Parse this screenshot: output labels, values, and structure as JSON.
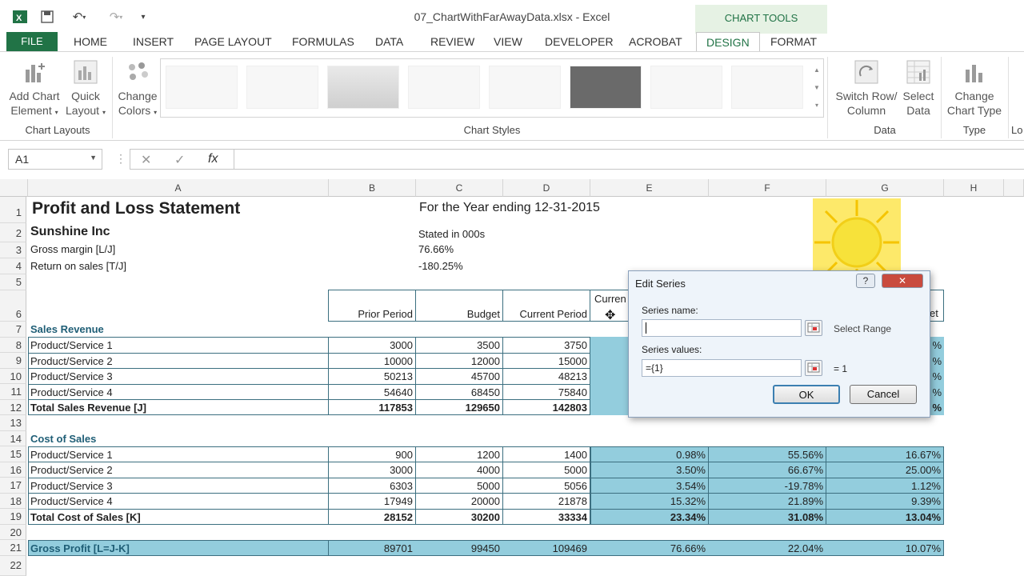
{
  "window": {
    "title": "07_ChartWithFarAwayData.xlsx - Excel",
    "context_tab_group": "CHART TOOLS",
    "colors": {
      "accent": "#217346",
      "fill_blue": "#93cddd",
      "teal_text": "#1f5e76"
    }
  },
  "tabs": {
    "file": "FILE",
    "items": [
      "HOME",
      "INSERT",
      "PAGE LAYOUT",
      "FORMULAS",
      "DATA",
      "REVIEW",
      "VIEW",
      "DEVELOPER",
      "ACROBAT",
      "DESIGN",
      "FORMAT"
    ],
    "active": "DESIGN"
  },
  "ribbon": {
    "add_chart_element": [
      "Add Chart",
      "Element"
    ],
    "quick_layout": [
      "Quick",
      "Layout"
    ],
    "change_colors": [
      "Change",
      "Colors"
    ],
    "switch_row_col": [
      "Switch Row/",
      "Column"
    ],
    "select_data": [
      "Select",
      "Data"
    ],
    "change_chart_type": [
      "Change",
      "Chart Type"
    ],
    "groups": {
      "chart_layouts": "Chart Layouts",
      "chart_styles": "Chart Styles",
      "data": "Data",
      "type": "Type",
      "cut_off": "Lo"
    }
  },
  "formula_bar": {
    "name_box": "A1",
    "fx": "fx",
    "value": ""
  },
  "columns": [
    "A",
    "B",
    "C",
    "D",
    "E",
    "F",
    "G",
    "H"
  ],
  "rows": [
    "1",
    "2",
    "3",
    "4",
    "5",
    "6",
    "7",
    "8",
    "9",
    "10",
    "11",
    "12",
    "13",
    "14",
    "15",
    "16",
    "17",
    "18",
    "19",
    "20",
    "21",
    "22"
  ],
  "sheet": {
    "title": "Profit and Loss Statement",
    "year_note": "For the Year ending 12-31-2015",
    "company": "Sunshine Inc",
    "stated": "Stated in 000s",
    "gross_margin_label": "Gross margin  [L/J]",
    "gross_margin_value": "76.66%",
    "ros_label": "Return on sales  [T/J]",
    "ros_value": "-180.25%",
    "headers": {
      "prior": "Prior Period",
      "budget": "Budget",
      "current": "Current Period",
      "e_partial": "Curren",
      "g_partial": "et"
    },
    "sales_revenue": "Sales Revenue",
    "sales_rows": [
      {
        "label": "Product/Service 1",
        "b": "3000",
        "c": "3500",
        "d": "3750"
      },
      {
        "label": "Product/Service 2",
        "b": "10000",
        "c": "12000",
        "d": "15000"
      },
      {
        "label": "Product/Service 3",
        "b": "50213",
        "c": "45700",
        "d": "48213"
      },
      {
        "label": "Product/Service 4",
        "b": "54640",
        "c": "68450",
        "d": "75840"
      }
    ],
    "sales_total": {
      "label": "Total Sales Revenue  [J]",
      "b": "117853",
      "c": "129650",
      "d": "142803"
    },
    "cost_of_sales": "Cost of Sales",
    "cost_rows": [
      {
        "label": "Product/Service 1",
        "b": "900",
        "c": "1200",
        "d": "1400",
        "e": "0.98%",
        "f": "55.56%",
        "g": "16.67%"
      },
      {
        "label": "Product/Service 2",
        "b": "3000",
        "c": "4000",
        "d": "5000",
        "e": "3.50%",
        "f": "66.67%",
        "g": "25.00%"
      },
      {
        "label": "Product/Service 3",
        "b": "6303",
        "c": "5000",
        "d": "5056",
        "e": "3.54%",
        "f": "-19.78%",
        "g": "1.12%"
      },
      {
        "label": "Product/Service 4",
        "b": "17949",
        "c": "20000",
        "d": "21878",
        "e": "15.32%",
        "f": "21.89%",
        "g": "9.39%"
      }
    ],
    "cost_total": {
      "label": "Total Cost of Sales  [K]",
      "b": "28152",
      "c": "30200",
      "d": "33334",
      "e": "23.34%",
      "f": "31.08%",
      "g": "13.04%"
    },
    "gross_profit": {
      "label": "Gross Profit  [L=J-K]",
      "b": "89701",
      "c": "99450",
      "d": "109469",
      "e": "76.66%",
      "f": "22.04%",
      "g": "10.07%"
    },
    "partial_g": [
      "%",
      "%",
      "%",
      "%",
      "%"
    ]
  },
  "dialog": {
    "title": "Edit Series",
    "help": "?",
    "close": "✕",
    "series_name_label": "Series name:",
    "series_name_value": "",
    "select_range": "Select Range",
    "series_values_label": "Series values:",
    "series_values_value": "={1}",
    "series_values_result": "= 1",
    "ok": "OK",
    "cancel": "Cancel"
  }
}
